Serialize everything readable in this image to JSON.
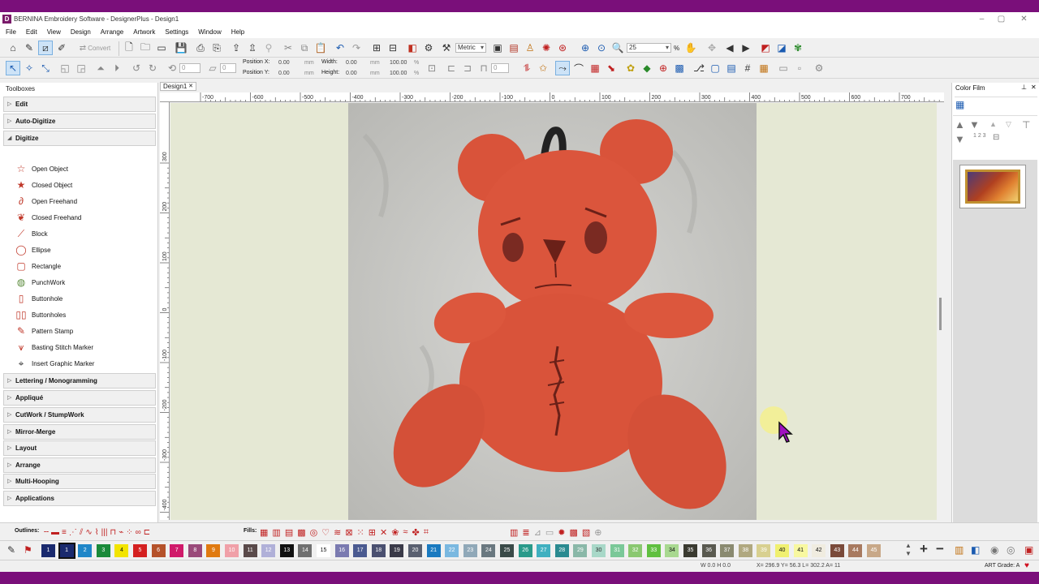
{
  "app": {
    "title": "BERNINA Embroidery Software - DesignerPlus - Design1",
    "logo_letter": "D"
  },
  "menu": [
    "File",
    "Edit",
    "View",
    "Design",
    "Arrange",
    "Artwork",
    "Settings",
    "Window",
    "Help"
  ],
  "toolbar1": {
    "convert_label": "Convert",
    "units_value": "Metric",
    "zoom_value": "25",
    "zoom_unit": "%"
  },
  "toolbar2": {
    "angle_value": "0",
    "rotate_value": "0",
    "position_x_label": "Position X:",
    "position_x_value": "0.00",
    "position_y_label": "Position Y:",
    "position_y_value": "0.00",
    "unit_mm": "mm",
    "width_label": "Width:",
    "width_value": "0.00",
    "height_label": "Height:",
    "height_value": "0.00",
    "scale_w": "100.00",
    "scale_h": "100.00",
    "pct": "%",
    "stitch_count": "0"
  },
  "toolboxes": {
    "header": "Toolboxes",
    "sections_top": [
      {
        "label": "Edit",
        "expanded": false
      },
      {
        "label": "Auto-Digitize",
        "expanded": false
      },
      {
        "label": "Digitize",
        "expanded": true
      }
    ],
    "digitize_tools": [
      {
        "label": "Open Object",
        "icon": "open-object-icon",
        "glyph": "☆"
      },
      {
        "label": "Closed Object",
        "icon": "closed-object-icon",
        "glyph": "★"
      },
      {
        "label": "Open Freehand",
        "icon": "open-freehand-icon",
        "glyph": "∂"
      },
      {
        "label": "Closed Freehand",
        "icon": "closed-freehand-icon",
        "glyph": "❦"
      },
      {
        "label": "Block",
        "icon": "block-icon",
        "glyph": "⟋"
      },
      {
        "label": "Ellipse",
        "icon": "ellipse-icon",
        "glyph": "◯"
      },
      {
        "label": "Rectangle",
        "icon": "rectangle-icon",
        "glyph": "▢"
      },
      {
        "label": "PunchWork",
        "icon": "punchwork-icon",
        "glyph": "◍"
      },
      {
        "label": "Buttonhole",
        "icon": "buttonhole-icon",
        "glyph": "▯"
      },
      {
        "label": "Buttonholes",
        "icon": "buttonholes-icon",
        "glyph": "▯▯"
      },
      {
        "label": "Pattern Stamp",
        "icon": "pattern-stamp-icon",
        "glyph": "✎"
      },
      {
        "label": "Basting Stitch Marker",
        "icon": "basting-marker-icon",
        "glyph": "⩛"
      },
      {
        "label": "Insert Graphic Marker",
        "icon": "graphic-marker-icon",
        "glyph": "⌖"
      }
    ],
    "sections_bottom": [
      "Lettering / Monogramming",
      "Appliqué",
      "CutWork / StumpWork",
      "Mirror-Merge",
      "Layout",
      "Arrange",
      "Multi-Hooping",
      "Applications"
    ]
  },
  "document": {
    "tab_label": "Design1",
    "ruler_top": [
      "-700",
      "-600",
      "-500",
      "-400",
      "-300",
      "-200",
      "-100",
      "0",
      "100",
      "200",
      "300",
      "400",
      "500",
      "600",
      "700"
    ],
    "ruler_left": [
      "300",
      "200",
      "100",
      "0",
      "-100",
      "-200",
      "-300",
      "-400"
    ]
  },
  "color_film": {
    "title": "Color Film",
    "sequence_label": "1 2 3"
  },
  "bottom_toolbar": {
    "outlines_label": "Outlines:",
    "fills_label": "Fills:"
  },
  "palette": {
    "swatches": [
      {
        "n": "1",
        "c": "#1a2a6e",
        "t": "#fff"
      },
      {
        "n": "1",
        "c": "#1a2a6e",
        "t": "#fff",
        "selected": true
      },
      {
        "n": "2",
        "c": "#1f86c8",
        "t": "#fff"
      },
      {
        "n": "3",
        "c": "#1a8a3a",
        "t": "#fff"
      },
      {
        "n": "4",
        "c": "#f2e400",
        "t": "#111"
      },
      {
        "n": "5",
        "c": "#d42020",
        "t": "#fff"
      },
      {
        "n": "6",
        "c": "#b5522a",
        "t": "#fff"
      },
      {
        "n": "7",
        "c": "#d01a6a",
        "t": "#fff"
      },
      {
        "n": "8",
        "c": "#9a4a7a",
        "t": "#fff"
      },
      {
        "n": "9",
        "c": "#e07a10",
        "t": "#fff"
      },
      {
        "n": "10",
        "c": "#f0a0a8",
        "t": "#fff"
      },
      {
        "n": "11",
        "c": "#5a4a4a",
        "t": "#fff"
      },
      {
        "n": "12",
        "c": "#b0b0d8",
        "t": "#fff"
      },
      {
        "n": "13",
        "c": "#111111",
        "t": "#fff"
      },
      {
        "n": "14",
        "c": "#707070",
        "t": "#fff"
      },
      {
        "n": "15",
        "c": "#ffffff",
        "t": "#111"
      },
      {
        "n": "16",
        "c": "#7a7ab0",
        "t": "#fff"
      },
      {
        "n": "17",
        "c": "#4a5a90",
        "t": "#fff"
      },
      {
        "n": "18",
        "c": "#4a5070",
        "t": "#fff"
      },
      {
        "n": "19",
        "c": "#3a3a48",
        "t": "#fff"
      },
      {
        "n": "20",
        "c": "#5a6070",
        "t": "#fff"
      },
      {
        "n": "21",
        "c": "#1a7ac0",
        "t": "#fff"
      },
      {
        "n": "22",
        "c": "#7ab8e0",
        "t": "#fff"
      },
      {
        "n": "23",
        "c": "#90a8b8",
        "t": "#fff"
      },
      {
        "n": "24",
        "c": "#6a7880",
        "t": "#fff"
      },
      {
        "n": "25",
        "c": "#3a4a48",
        "t": "#fff"
      },
      {
        "n": "26",
        "c": "#2a9a8a",
        "t": "#fff"
      },
      {
        "n": "27",
        "c": "#40b0c0",
        "t": "#fff"
      },
      {
        "n": "28",
        "c": "#2a8a90",
        "t": "#fff"
      },
      {
        "n": "29",
        "c": "#8ab8a8",
        "t": "#fff"
      },
      {
        "n": "30",
        "c": "#a8d8c8",
        "t": "#333"
      },
      {
        "n": "31",
        "c": "#7ac898",
        "t": "#fff"
      },
      {
        "n": "32",
        "c": "#8ac870",
        "t": "#fff"
      },
      {
        "n": "33",
        "c": "#60c040",
        "t": "#fff"
      },
      {
        "n": "34",
        "c": "#a8d890",
        "t": "#111"
      },
      {
        "n": "35",
        "c": "#3a3a30",
        "t": "#fff"
      },
      {
        "n": "36",
        "c": "#5a5a50",
        "t": "#fff"
      },
      {
        "n": "37",
        "c": "#8a8a70",
        "t": "#fff"
      },
      {
        "n": "38",
        "c": "#b0a880",
        "t": "#fff"
      },
      {
        "n": "39",
        "c": "#d8d090",
        "t": "#fff"
      },
      {
        "n": "40",
        "c": "#f0f070",
        "t": "#111"
      },
      {
        "n": "41",
        "c": "#f8f8a0",
        "t": "#111"
      },
      {
        "n": "42",
        "c": "#f0ece0",
        "t": "#111"
      },
      {
        "n": "43",
        "c": "#7a4a3a",
        "t": "#fff"
      },
      {
        "n": "44",
        "c": "#a87a60",
        "t": "#fff"
      },
      {
        "n": "45",
        "c": "#c8a888",
        "t": "#fff"
      }
    ]
  },
  "status": {
    "stitch_info": "W  0.0 H  0.0",
    "coords": "X= 296.9 Y=  56.3 L= 302.2 A=  11",
    "grade": "ART Grade: A"
  },
  "colors": {
    "accent": "#7a0f7a",
    "canvas_bg": "#e5e8d4",
    "tool_icon": "#c0392b"
  }
}
